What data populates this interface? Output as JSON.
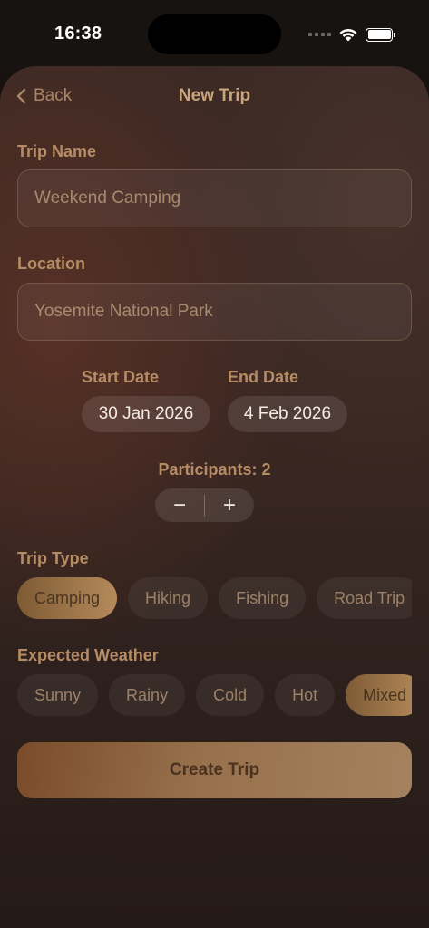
{
  "status": {
    "time": "16:38"
  },
  "nav": {
    "back_label": "Back",
    "title": "New Trip"
  },
  "form": {
    "trip_name": {
      "label": "Trip Name",
      "value": "Weekend Camping"
    },
    "location": {
      "label": "Location",
      "value": "Yosemite National Park"
    },
    "start_date": {
      "label": "Start Date",
      "value": "30 Jan 2026"
    },
    "end_date": {
      "label": "End Date",
      "value": "4 Feb 2026"
    },
    "participants": {
      "label": "Participants: 2",
      "value": 2,
      "decrement": "−",
      "increment": "+"
    },
    "trip_type": {
      "label": "Trip Type",
      "options": [
        "Camping",
        "Hiking",
        "Fishing",
        "Road Trip"
      ],
      "selected": "Camping"
    },
    "weather": {
      "label": "Expected Weather",
      "options": [
        "Sunny",
        "Rainy",
        "Cold",
        "Hot",
        "Mixed"
      ],
      "selected": "Mixed"
    }
  },
  "create_button": "Create Trip",
  "colors": {
    "accent": "#b58a5b",
    "background": "#2e211d",
    "label": "#b58c65"
  }
}
